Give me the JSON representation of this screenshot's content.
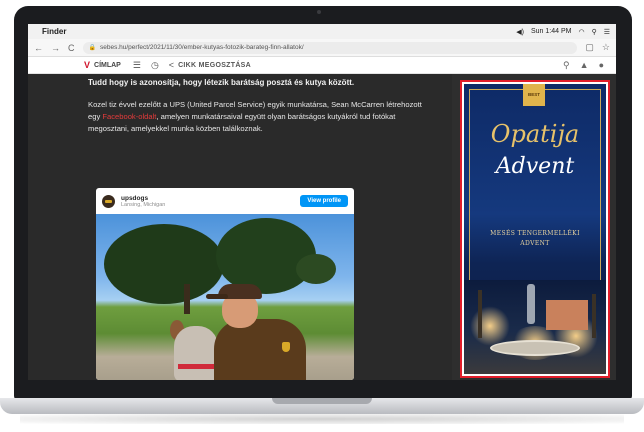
{
  "menubar": {
    "app": "Finder",
    "time": "Sun 1:44 PM"
  },
  "browser": {
    "url": "sebes.hu/perfect/2021/11/30/ember-kutyas-fotozik-barateg-finn-allatok/",
    "nav_glyphs": [
      "←",
      "→",
      "C"
    ],
    "right_glyphs": [
      "▢",
      "☆"
    ]
  },
  "site_nav": {
    "logo": "V",
    "home_label": "CÍMLAP",
    "share_label": "CIKK MEGOSZTÁSA",
    "icons": [
      "menu-icon",
      "clock-icon",
      "share-icon",
      "search-icon",
      "bell-icon",
      "user-icon"
    ]
  },
  "article": {
    "lead": "Tudd hogy is azonosítja, hogy létezik barátság posztá és kutya között.",
    "para_before_link": "Kozel tiz évvel ezelőtt a UPS (United Parcel Service) egyik munkatársa, Sean McCarren létrehozott egy ",
    "para_link": "Facebook-oldalt",
    "para_after_link": ", amelyen munkatársaival együtt olyan barátságos kutyákról tud fotókat megosztani, amelyekkel munka közben találkoznak."
  },
  "embed": {
    "account": "upsdogs",
    "location": "Lansing, Michigan",
    "view_button": "View profile"
  },
  "ad": {
    "badge": "BEST",
    "title1": "Opatija",
    "title2": "Advent",
    "subtitle1": "MESÉS TENGERMELLÉKI",
    "subtitle2": "ADVENT",
    "border_color": "#e21d2a"
  }
}
